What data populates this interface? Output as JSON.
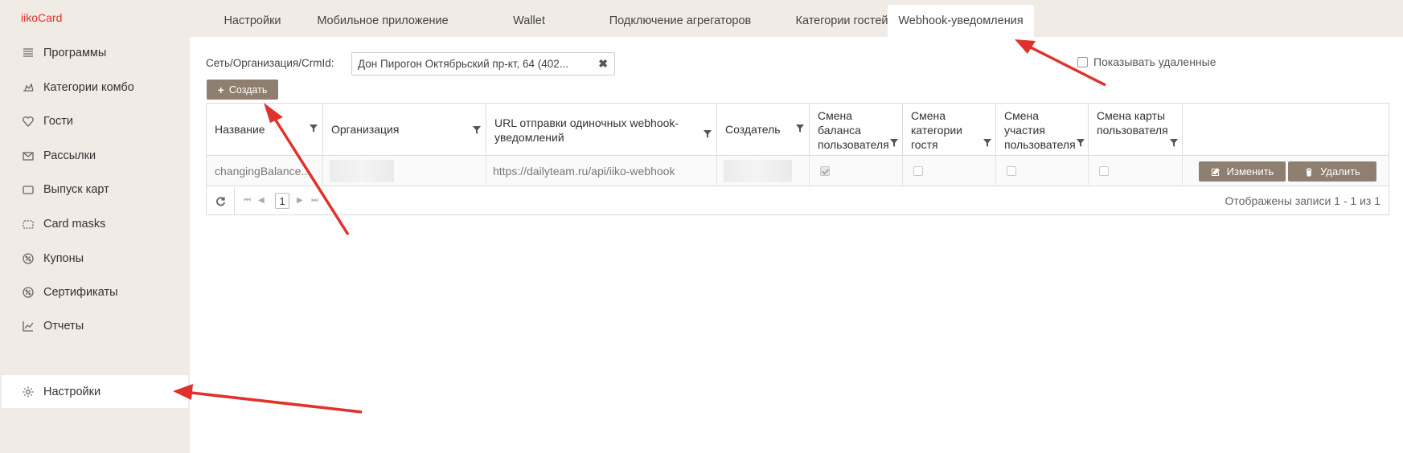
{
  "brand": "iikoCard",
  "sidebar": {
    "items": [
      {
        "label": "Программы",
        "icon": "list-icon"
      },
      {
        "label": "Категории комбо",
        "icon": "combo-icon"
      },
      {
        "label": "Гости",
        "icon": "heart-icon"
      },
      {
        "label": "Рассылки",
        "icon": "envelope-icon"
      },
      {
        "label": "Выпуск карт",
        "icon": "card-icon"
      },
      {
        "label": "Card masks",
        "icon": "dashed-card-icon"
      },
      {
        "label": "Купоны",
        "icon": "percent-icon"
      },
      {
        "label": "Сертификаты",
        "icon": "percent-icon"
      },
      {
        "label": "Отчеты",
        "icon": "chart-icon"
      },
      {
        "label": "Настройки",
        "icon": "gear-icon",
        "active": true
      }
    ]
  },
  "tabs": [
    {
      "label": "Настройки"
    },
    {
      "label": "Мобильное приложение"
    },
    {
      "label": "Wallet"
    },
    {
      "label": "Подключение агрегаторов"
    },
    {
      "label": "Категории гостей"
    },
    {
      "label": "Webhook-уведомления",
      "active": true
    }
  ],
  "filter": {
    "label": "Сеть/Организация/CrmId:",
    "value": "Дон Пирогон Октябрьский пр-кт, 64 (402...",
    "clear": "✖"
  },
  "show_deleted": {
    "label": "Показывать удаленные",
    "checked": false
  },
  "create_button": {
    "label": "Создать",
    "icon": "plus-icon"
  },
  "table": {
    "columns": [
      {
        "label": "Название"
      },
      {
        "label": "Организация"
      },
      {
        "label": "URL отправки одиночных webhook-уведомлений"
      },
      {
        "label": "Создатель"
      },
      {
        "label": "Смена баланса пользователя"
      },
      {
        "label": "Смена категории гостя"
      },
      {
        "label": "Смена участия пользователя"
      },
      {
        "label": "Смена карты пользователя"
      }
    ],
    "rows": [
      {
        "name": "changingBalance...",
        "url": "https://dailyteam.ru/api/iiko-webhook",
        "balance": true,
        "category": false,
        "participation": false,
        "card": false
      }
    ],
    "edit_label": "Изменить",
    "delete_label": "Удалить"
  },
  "pager": {
    "first": "⏮",
    "prev": "◀",
    "page": "1",
    "next": "▶",
    "last": "⏭",
    "records": "Отображены записи 1 - 1 из 1"
  },
  "colors": {
    "accent": "#8f7f71",
    "sidebar_bg": "#f1ebe6",
    "brand": "#e0312a",
    "annotation_arrow": "#e0312a"
  }
}
